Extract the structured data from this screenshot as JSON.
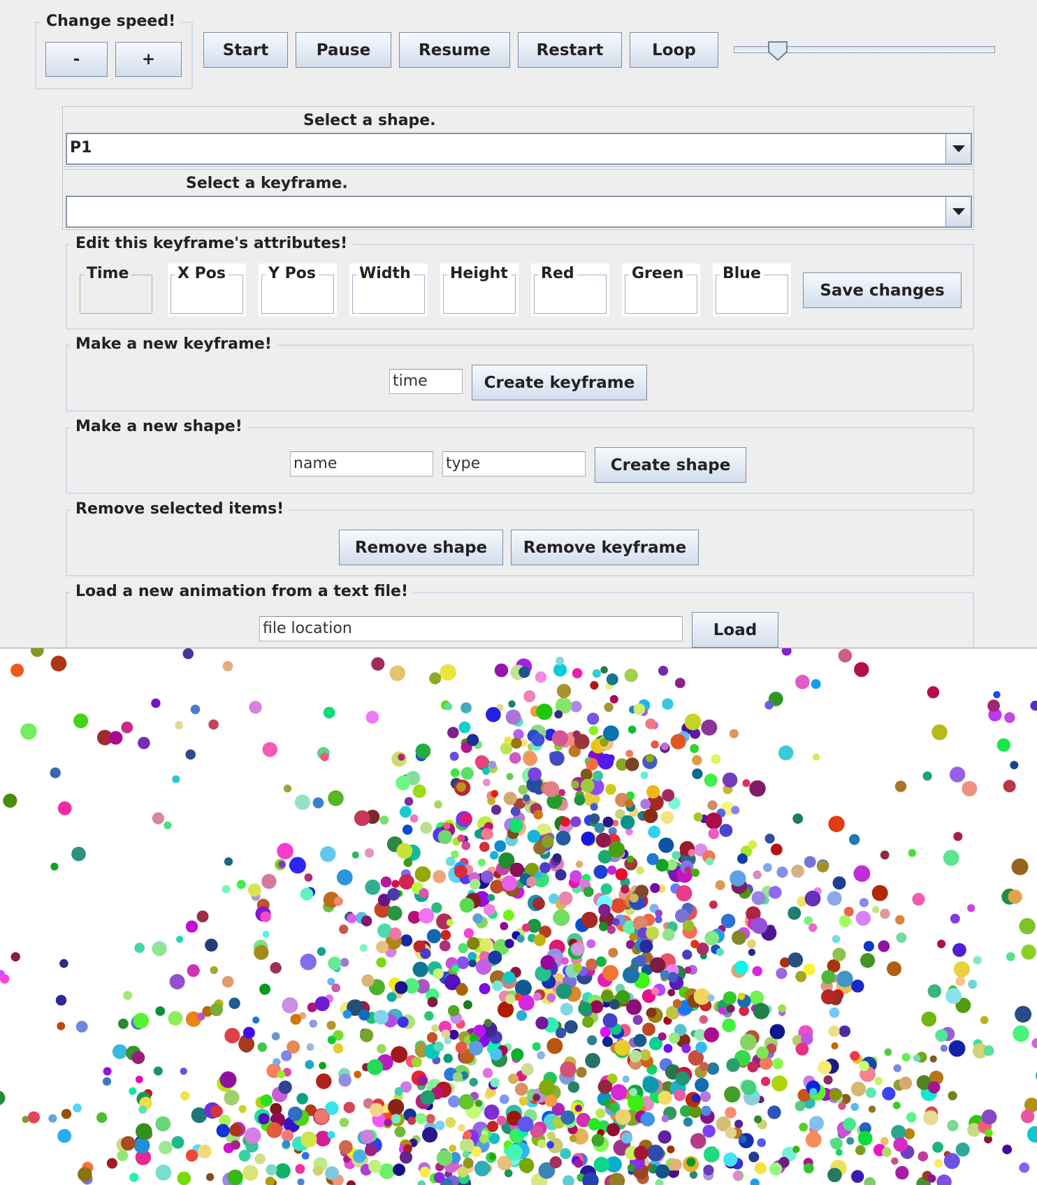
{
  "speed": {
    "title": "Change speed!",
    "decrease_label": "-",
    "increase_label": "+"
  },
  "playback": {
    "start_label": "Start",
    "pause_label": "Pause",
    "resume_label": "Resume",
    "restart_label": "Restart",
    "loop_label": "Loop",
    "slider_value": 0.14
  },
  "shape_select": {
    "title": "Select a shape.",
    "value": "P1"
  },
  "keyframe_select": {
    "title": "Select a keyframe.",
    "value": ""
  },
  "edit_keyframe": {
    "title": "Edit this keyframe's attributes!",
    "fields": [
      "Time",
      "X Pos",
      "Y Pos",
      "Width",
      "Height",
      "Red",
      "Green",
      "Blue"
    ],
    "save_label": "Save changes"
  },
  "new_keyframe": {
    "title": "Make a new keyframe!",
    "time_value": "time",
    "create_label": "Create keyframe"
  },
  "new_shape": {
    "title": "Make a new shape!",
    "name_value": "name",
    "type_value": "type",
    "create_label": "Create shape"
  },
  "remove_items": {
    "title": "Remove selected items!",
    "remove_shape_label": "Remove shape",
    "remove_keyframe_label": "Remove keyframe"
  },
  "load_animation": {
    "title": "Load a new animation from a text file!",
    "file_value": "file location",
    "load_label": "Load"
  },
  "colors": {
    "background": "#eeeeee",
    "canvas": "#ffffff",
    "group_border": "#cfdbe9"
  }
}
